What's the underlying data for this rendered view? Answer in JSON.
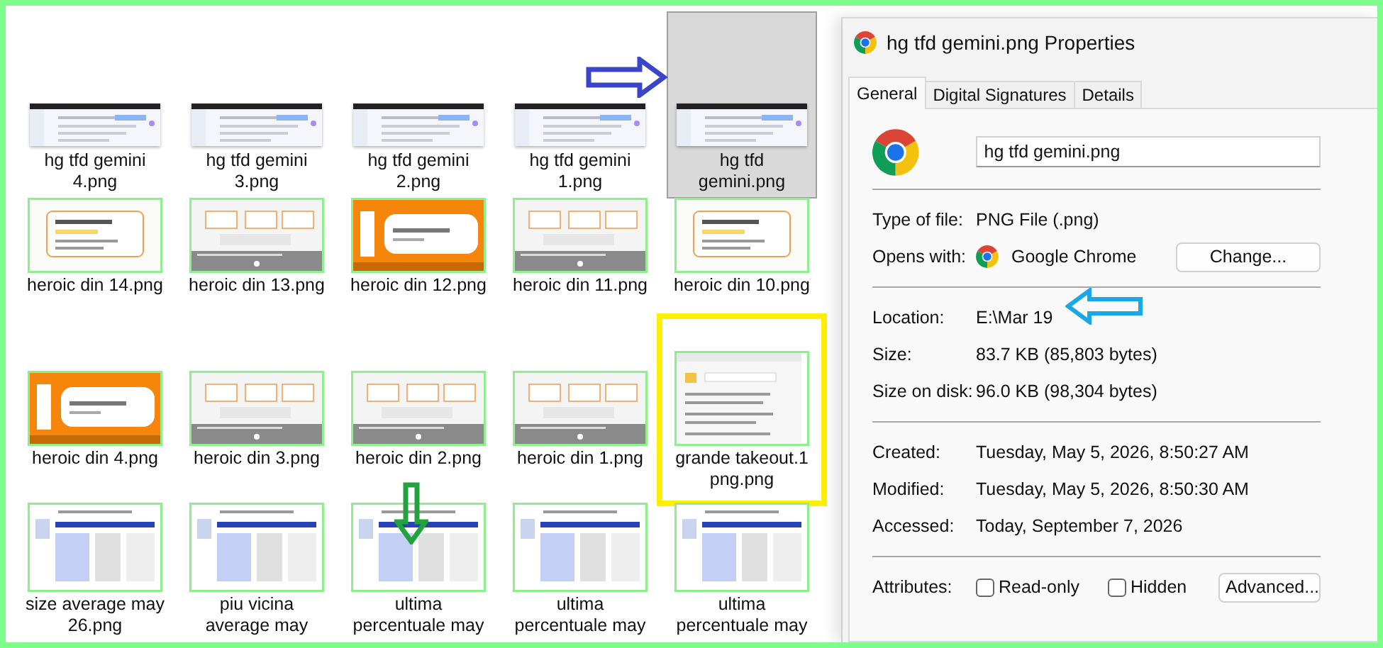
{
  "files": [
    {
      "name": "hg tfd gemini\n4.png",
      "selected": false,
      "highlighted": false
    },
    {
      "name": "hg tfd gemini\n3.png",
      "selected": false,
      "highlighted": false
    },
    {
      "name": "hg tfd gemini\n2.png",
      "selected": false,
      "highlighted": false
    },
    {
      "name": "hg tfd gemini\n1.png",
      "selected": false,
      "highlighted": false
    },
    {
      "name": "hg tfd\ngemini.png",
      "selected": true,
      "highlighted": false
    },
    {
      "name": "heroic din 14.png",
      "selected": false,
      "highlighted": false
    },
    {
      "name": "heroic din 13.png",
      "selected": false,
      "highlighted": false
    },
    {
      "name": "heroic din 12.png",
      "selected": false,
      "highlighted": false
    },
    {
      "name": "heroic din 11.png",
      "selected": false,
      "highlighted": false
    },
    {
      "name": "heroic din 10.png",
      "selected": false,
      "highlighted": false
    },
    {
      "name": "heroic din 4.png",
      "selected": false,
      "highlighted": false
    },
    {
      "name": "heroic din 3.png",
      "selected": false,
      "highlighted": false
    },
    {
      "name": "heroic din 2.png",
      "selected": false,
      "highlighted": false
    },
    {
      "name": "heroic din 1.png",
      "selected": false,
      "highlighted": false
    },
    {
      "name": "grande takeout.1\npng.png",
      "selected": false,
      "highlighted": true
    },
    {
      "name": "size average may\n26.png",
      "selected": false,
      "highlighted": false
    },
    {
      "name": "piu vicina\naverage may",
      "selected": false,
      "highlighted": false
    },
    {
      "name": "ultima\npercentuale may",
      "selected": false,
      "highlighted": false
    },
    {
      "name": "ultima\npercentuale may",
      "selected": false,
      "highlighted": false
    },
    {
      "name": "ultima\npercentuale may",
      "selected": false,
      "highlighted": false
    }
  ],
  "dialog": {
    "title": "hg tfd gemini.png Properties",
    "tabs": [
      {
        "label": "General",
        "selected": true
      },
      {
        "label": "Digital Signatures",
        "selected": false
      },
      {
        "label": "Details",
        "selected": false
      }
    ],
    "file_name": "hg tfd gemini.png",
    "sections": [
      [
        {
          "kind": "text",
          "label": "Type of file:",
          "value": "PNG File (.png)"
        },
        {
          "kind": "app",
          "label": "Opens with:",
          "value": "Google Chrome",
          "button": "Change..."
        }
      ],
      [
        {
          "kind": "text",
          "label": "Location:",
          "value": "E:\\Mar 19"
        },
        {
          "kind": "text",
          "label": "Size:",
          "value": "83.7 KB (85,803 bytes)"
        },
        {
          "kind": "text",
          "label": "Size on disk:",
          "value": "96.0 KB (98,304 bytes)"
        }
      ],
      [
        {
          "kind": "text",
          "label": "Created:",
          "value": "Tuesday, May 5, 2026, 8:50:27 AM"
        },
        {
          "kind": "text",
          "label": "Modified:",
          "value": "Tuesday, May 5, 2026, 8:50:30 AM"
        },
        {
          "kind": "text",
          "label": "Accessed:",
          "value": "Today, September 7, 2026"
        }
      ]
    ],
    "attributes": {
      "label": "Attributes:",
      "options": [
        {
          "label": "Read-only",
          "checked": false
        },
        {
          "label": "Hidden",
          "checked": false
        }
      ],
      "button": "Advanced..."
    }
  }
}
